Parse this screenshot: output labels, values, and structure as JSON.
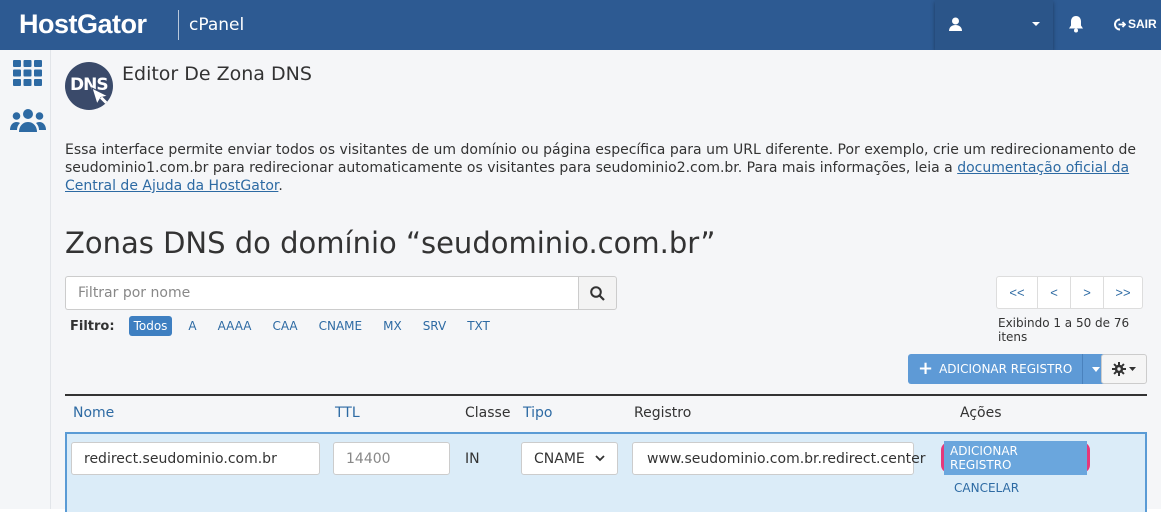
{
  "header": {
    "brand": "HostGator",
    "product": "cPanel",
    "logout_label": "SAIR"
  },
  "page": {
    "title": "Editor De Zona DNS",
    "icon_label": "DNS",
    "description_text": "Essa interface permite enviar todos os visitantes de um domínio ou página específica para um URL diferente. Por exemplo, crie um redirecionamento de seudominio1.com.br para redirecionar automaticamente os visitantes para seudominio2.com.br. Para mais informações, leia a ",
    "description_link": "documentação oficial da Central de Ajuda da HostGator",
    "description_end": "."
  },
  "zone": {
    "title": "Zonas DNS do domínio “seudominio.com.br”"
  },
  "search": {
    "placeholder": "Filtrar por nome"
  },
  "filter": {
    "label": "Filtro:",
    "items": [
      "Todos",
      "A",
      "AAAA",
      "CAA",
      "CNAME",
      "MX",
      "SRV",
      "TXT"
    ]
  },
  "pagination": {
    "first": "<<",
    "prev": "<",
    "next": ">",
    "last": ">>",
    "info": "Exibindo 1 a 50 de 76 itens"
  },
  "toolbar": {
    "add_label": "ADICIONAR REGISTRO"
  },
  "table": {
    "headers": {
      "name": "Nome",
      "ttl": "TTL",
      "class": "Classe",
      "type": "Tipo",
      "record": "Registro",
      "actions": "Ações"
    }
  },
  "edit_row": {
    "name_value": "redirect.seudominio.com.br",
    "ttl_placeholder": "14400",
    "class_value": "IN",
    "type_value": "CNAME",
    "record_value": "www.seudominio.com.br.redirect.center",
    "save_label": "ADICIONAR REGISTRO",
    "cancel_label": "CANCELAR"
  },
  "colors": {
    "header_bg": "#2d5a92",
    "link": "#2d6aa3",
    "highlight": "#e6387b",
    "edit_row_bg": "#dbecf8"
  }
}
